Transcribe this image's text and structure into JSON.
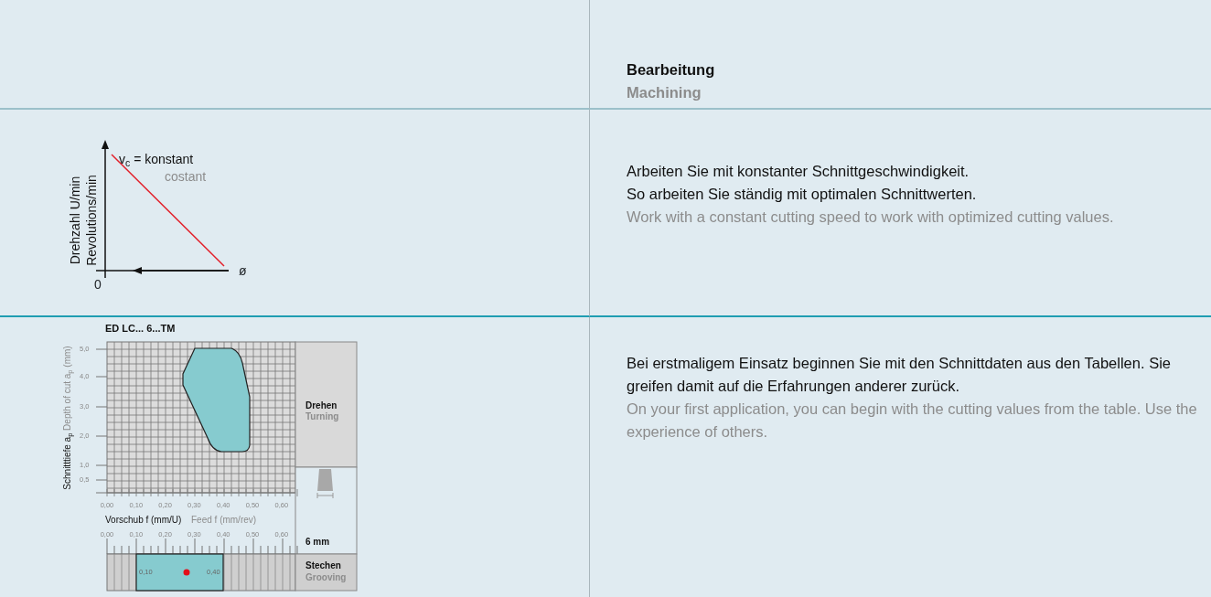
{
  "header": {
    "title": "Bearbeitung",
    "subtitle": "Machining"
  },
  "sections": [
    {
      "kind": "speed-diagram",
      "diagram": {
        "y_label_de": "Drehzahl U/min",
        "y_label_en": "Revolutions/min",
        "formula_de": "v$_{c}$ = konstant",
        "formula_en": "costant",
        "origin": "0",
        "x_label": "ø"
      },
      "text_de": [
        "Arbeiten Sie mit konstanter Schnittgeschwindigkeit.",
        "So arbeiten Sie ständig mit optimalen Schnittwerten."
      ],
      "text_en": [
        "Work with a constant cutting speed to work with optimized cutting values."
      ]
    },
    {
      "kind": "cutting-data-diagram",
      "diagram": {
        "title": "ED LC... 6...TM",
        "y_label_de": "Schnitttiefe a$_{p}$",
        "y_label_en": "Depth of cut a$_{p}$ (mm)",
        "y_ticks": [
          "5,0",
          "4,0",
          "3,0",
          "2,0",
          "1,0",
          "0,5"
        ],
        "x_ticks_upper": [
          "0,00",
          "0,10",
          "0,20",
          "0,30",
          "0,40",
          "0,50",
          "0,60"
        ],
        "x_label_de": "Vorschub f (mm/U)",
        "x_label_en": "Feed f (mm/rev)",
        "x_ticks_lower": [
          "0,00",
          "0,10",
          "0,20",
          "0,30",
          "0,40",
          "0,50",
          "0,60"
        ],
        "turning_de": "Drehen",
        "turning_en": "Turning",
        "tool_width": "6 mm",
        "grooving_de": "Stechen",
        "grooving_en": "Grooving",
        "range_min": "0,10",
        "range_max": "0,40"
      },
      "text_de": [
        "Bei erstmaligem Einsatz beginnen Sie mit den Schnittdaten aus den Tabellen. Sie greifen damit auf die Erfahrungen anderer zurück."
      ],
      "text_en": [
        "On your first application, you can begin with the cutting values from the table. Use the experience of others."
      ]
    }
  ]
}
